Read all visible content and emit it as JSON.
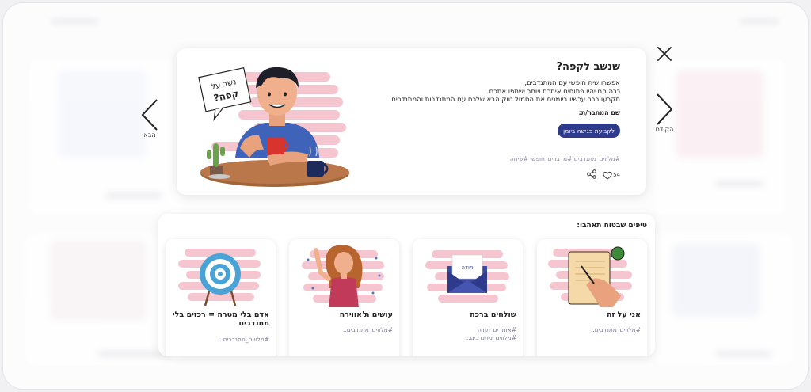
{
  "nav": {
    "next_label": "הבא",
    "prev_label": "הקודם"
  },
  "main": {
    "title": "שנשב לקפה?",
    "description_lines": [
      "אפשרו שיח חופשי עם המתנדבים,",
      "ככה הם יהיו פתוחים איתכם ויותר ישתפו אתכם.",
      "תקבעו כבר עכשיו ביומנים את הסמול טוק הבא שלכם עם המתנדבות והמתנדבים"
    ],
    "speaker_label": "שם המחבר/ת:",
    "meeting_button": "לקביעת פגישה ביומן",
    "tags": "#מלווים_מתנדבים #מדברים_חופשי #שיחה",
    "like_count": "54",
    "illustration_sign": "נשב על קפה?"
  },
  "tips": {
    "title": "טיפים שבטוח תאהבו:",
    "items": [
      {
        "title": "אני על זה",
        "tags": [
          "#מלווים_מתנדבים.."
        ],
        "icon": "notebook-icon"
      },
      {
        "title": "שולחים ברכה",
        "tags": [
          "#אומרים_תודה",
          "#מלווים_מתנדבים.."
        ],
        "icon": "envelope-icon"
      },
      {
        "title": "עושים ת'אווירה",
        "tags": [
          "#מלווים_מתנדבים.."
        ],
        "icon": "waving-woman-icon"
      },
      {
        "title": "אדם בלי מטרה = רכזים בלי מתנדבים",
        "tags": [
          "#מלווים_מתנדבים.."
        ],
        "icon": "target-icon"
      }
    ]
  },
  "envelope_label": "תודה",
  "colors": {
    "primary": "#2e3a8c",
    "blob": "#f6c6d0",
    "tag": "#8a8aa8"
  }
}
